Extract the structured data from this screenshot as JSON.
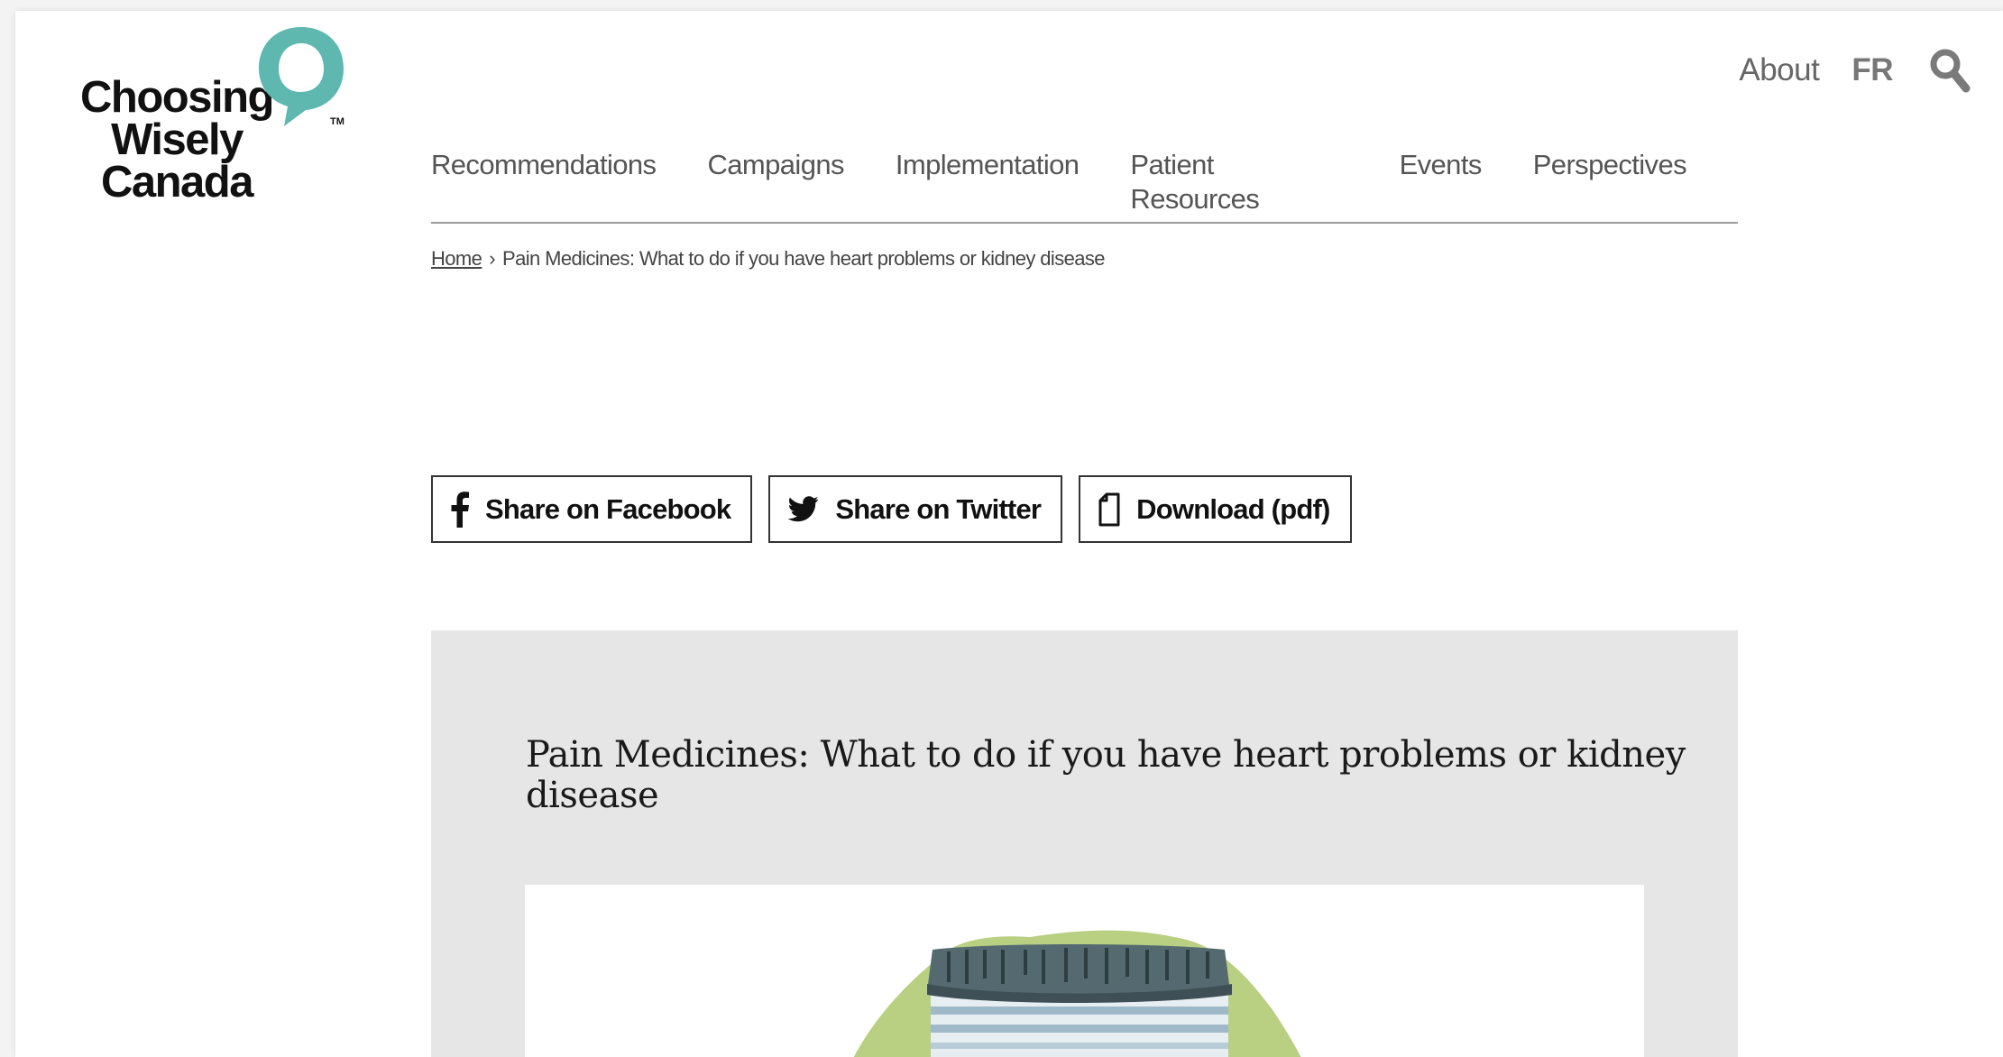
{
  "logo": {
    "lines": [
      "Choosing",
      "Wisely",
      "Canada"
    ],
    "trademark": "TM",
    "bubble_color": "#5fb8b0"
  },
  "utility_nav": {
    "about": "About",
    "language": "FR",
    "search_icon": "search-icon"
  },
  "main_nav": {
    "items": [
      {
        "label": "Recommendations"
      },
      {
        "label": "Campaigns"
      },
      {
        "label": "Implementation"
      },
      {
        "label": "Patient Resources"
      },
      {
        "label": "Events"
      },
      {
        "label": "Perspectives"
      }
    ]
  },
  "breadcrumb": {
    "home": "Home",
    "separator": "›",
    "current": "Pain Medicines: What to do if you have heart problems or kidney disease"
  },
  "share": {
    "facebook": {
      "label": "Share on Facebook",
      "icon": "facebook-icon"
    },
    "twitter": {
      "label": "Share on Twitter",
      "icon": "twitter-icon"
    },
    "download": {
      "label": "Download (pdf)",
      "icon": "document-icon"
    }
  },
  "article": {
    "title": "Pain Medicines: What to do if you have heart problems or kidney disease",
    "panel_color": "#e6e6e6",
    "illustration": "pill-bottle-illustration"
  }
}
